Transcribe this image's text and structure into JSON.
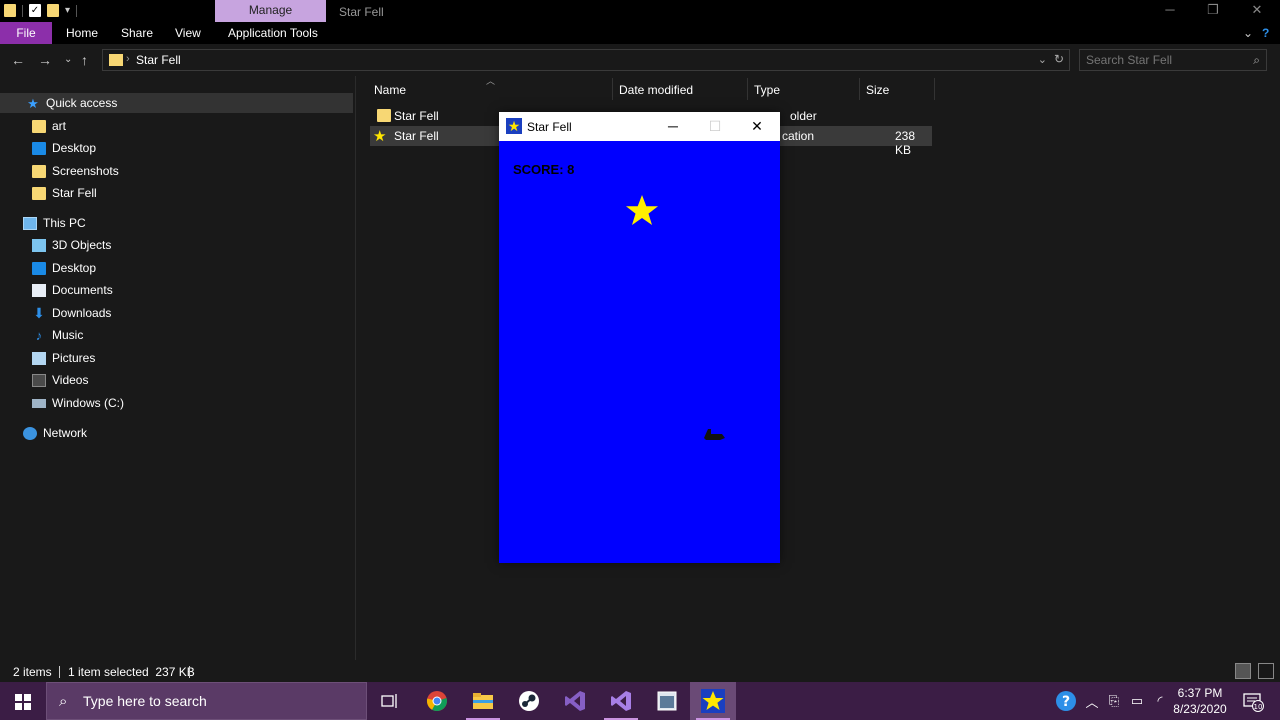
{
  "titlebar": {
    "manage_label": "Manage",
    "window_title": "Star Fell",
    "minimize_icon": "minimize-icon",
    "maximize_icon": "restore-icon",
    "close_icon": "close-icon"
  },
  "ribbon": {
    "tabs": [
      {
        "label": "File"
      },
      {
        "label": "Home"
      },
      {
        "label": "Share"
      },
      {
        "label": "View"
      },
      {
        "label": "Application Tools"
      }
    ]
  },
  "address": {
    "path": "Star Fell",
    "search_placeholder": "Search Star Fell"
  },
  "sidebar": {
    "quick_access": "Quick access",
    "quick_items": [
      "art",
      "Desktop",
      "Screenshots",
      "Star Fell"
    ],
    "this_pc": "This PC",
    "pc_items": [
      "3D Objects",
      "Desktop",
      "Documents",
      "Downloads",
      "Music",
      "Pictures",
      "Videos",
      "Windows (C:)"
    ],
    "network": "Network"
  },
  "filelist": {
    "columns": [
      "Name",
      "Date modified",
      "Type",
      "Size"
    ],
    "rows": [
      {
        "name": "Star Fell",
        "date": "",
        "type": "older",
        "size": "",
        "icon": "folder-icon"
      },
      {
        "name": "Star Fell",
        "date": "",
        "type": "cation",
        "size": "238 KB",
        "icon": "star-app-icon"
      }
    ]
  },
  "game": {
    "title": "Star Fell",
    "score_text": "SCORE: 8",
    "canvas_color": "#0000ff",
    "star_color": "#ffee00"
  },
  "statusbar": {
    "items_count": "2 items",
    "selected": "1 item selected  237 KB"
  },
  "taskbar": {
    "search_placeholder": "Type here to search",
    "apps": [
      "task-view-icon",
      "chrome-icon",
      "file-explorer-icon",
      "steam-icon",
      "visual-studio-icon",
      "visual-studio-preview-icon",
      "app-window-icon",
      "star-fell-icon"
    ],
    "time": "6:37 PM",
    "date": "8/23/2020",
    "notification_count": "10"
  }
}
